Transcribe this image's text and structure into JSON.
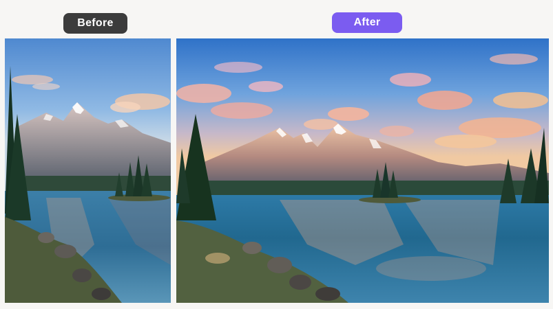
{
  "comparison": {
    "before_label": "Before",
    "after_label": "After"
  },
  "colors": {
    "before_badge": "#3c3c3c",
    "after_badge": "#7b5cf0",
    "background": "#f7f6f4"
  },
  "images": {
    "before": "mountain-lake-photo",
    "after": "mountain-lake-photo-enhanced"
  }
}
